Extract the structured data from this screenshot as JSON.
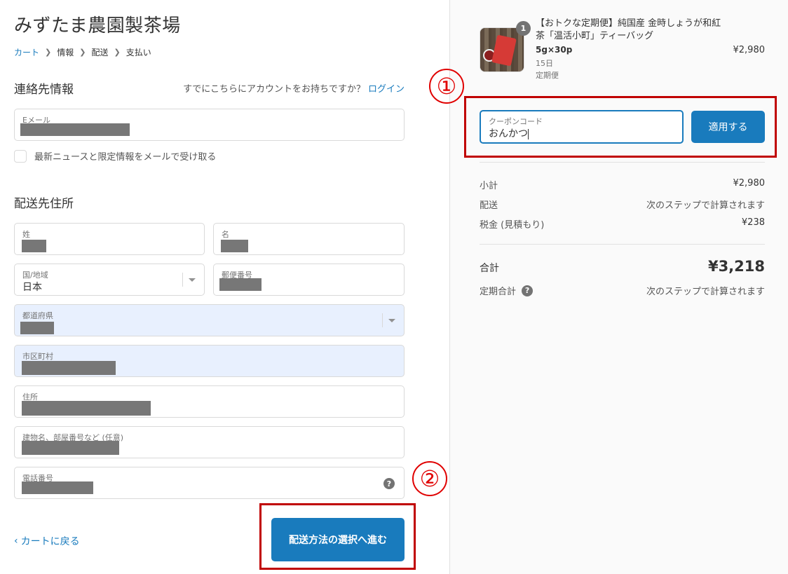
{
  "shop": {
    "title": "みずたま農園製茶場"
  },
  "breadcrumb": [
    {
      "label": "カート",
      "link": true
    },
    {
      "label": "情報",
      "link": false
    },
    {
      "label": "配送",
      "link": false
    },
    {
      "label": "支払い",
      "link": false
    }
  ],
  "contact": {
    "title": "連絡先情報",
    "have_account": "すでにこちらにアカウントをお持ちですか？",
    "login": "ログイン",
    "email_label": "Eメール",
    "newsletter_label": "最新ニュースと限定情報をメールで受け取る"
  },
  "shipping": {
    "title": "配送先住所",
    "last_name_label": "姓",
    "first_name_label": "名",
    "country_label": "国/地域",
    "country_value": "日本",
    "postal_label": "郵便番号",
    "prefecture_label": "都道府県",
    "city_label": "市区町村",
    "address_label": "住所",
    "building_label": "建物名、部屋番号など (任意)",
    "phone_label": "電話番号"
  },
  "actions": {
    "back": "カートに戻る",
    "continue": "配送方法の選択へ進む"
  },
  "product": {
    "quantity": "1",
    "name": "【おトクな定期便】純国産 金時しょうが和紅茶「温活小町」ティーバッグ",
    "variant": "5g×30p",
    "interval": "15日",
    "plan": "定期便",
    "price": "¥2,980"
  },
  "coupon": {
    "label": "クーポンコード",
    "value": "おんかつ",
    "apply": "適用する"
  },
  "summary": {
    "subtotal_label": "小計",
    "subtotal_value": "¥2,980",
    "shipping_label": "配送",
    "shipping_value": "次のステップで計算されます",
    "tax_label": "税金 (見積もり)",
    "tax_value": "¥238",
    "total_label": "合計",
    "total_value": "¥3,218",
    "recurring_label": "定期合計",
    "recurring_value": "次のステップで計算されます"
  },
  "annotations": {
    "one": "①",
    "two": "②"
  },
  "icons": {
    "help": "?"
  },
  "colors": {
    "accent": "#197bbd",
    "annotation": "#c00000"
  }
}
